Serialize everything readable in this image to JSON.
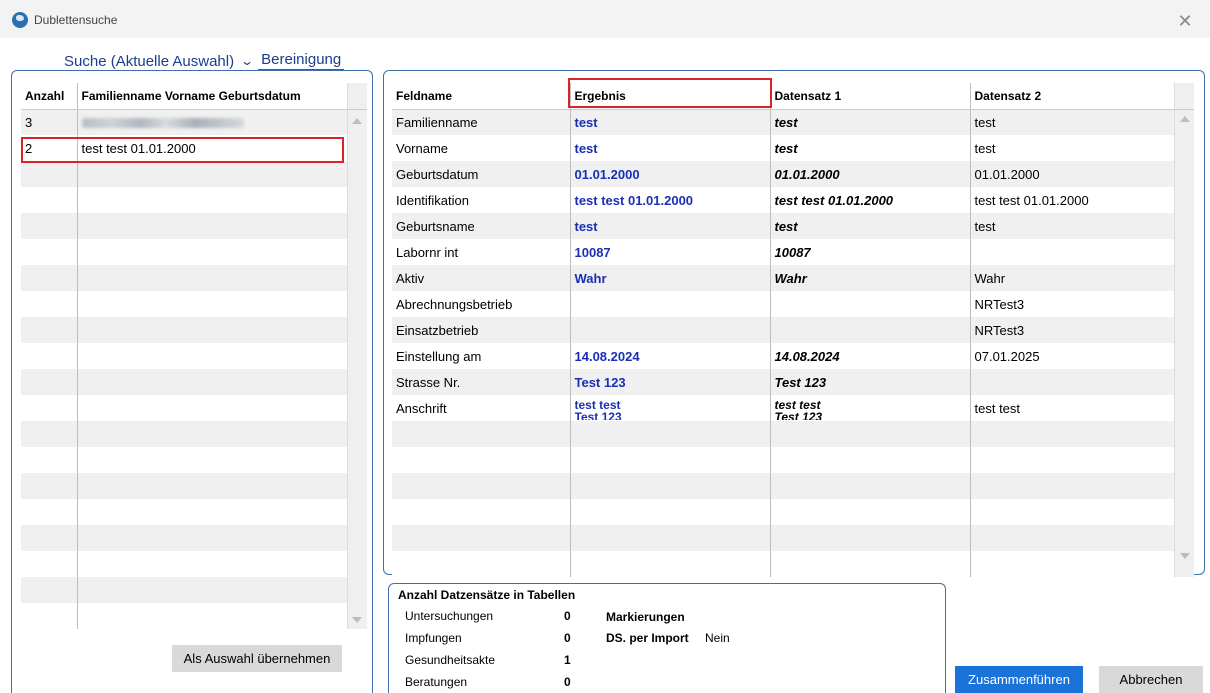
{
  "window": {
    "title": "Dublettensuche",
    "close_glyph": "✕",
    "icon": "globe-icon"
  },
  "tabs": {
    "search": "Suche (Aktuelle Auswahl)",
    "chevron": "⌄",
    "cleanup": "Bereinigung"
  },
  "left": {
    "col_count": "Anzahl",
    "col_name": "Familienname Vorname Geburtsdatum",
    "rows": [
      {
        "count": "3",
        "name": ""
      },
      {
        "count": "2",
        "name": "test test 01.01.2000"
      }
    ],
    "apply_button": "Als Auswahl übernehmen"
  },
  "right": {
    "col_field": "Feldname",
    "col_result": "Ergebnis",
    "col_ds1": "Datensatz 1",
    "col_ds2": "Datensatz 2",
    "rows": [
      {
        "field": "Familienname",
        "result": "test",
        "ds1": "test",
        "ds2": "test"
      },
      {
        "field": "Vorname",
        "result": "test",
        "ds1": "test",
        "ds2": "test"
      },
      {
        "field": "Geburtsdatum",
        "result": "01.01.2000",
        "ds1": "01.01.2000",
        "ds2": "01.01.2000"
      },
      {
        "field": "Identifikation",
        "result": "test test  01.01.2000",
        "ds1": "test test  01.01.2000",
        "ds2": "test test  01.01.2000"
      },
      {
        "field": "Geburtsname",
        "result": "test",
        "ds1": "test",
        "ds2": "test"
      },
      {
        "field": "Labornr int",
        "result": "10087",
        "ds1": "10087",
        "ds2": ""
      },
      {
        "field": "Aktiv",
        "result": "Wahr",
        "ds1": "Wahr",
        "ds2": "Wahr"
      },
      {
        "field": "Abrechnungsbetrieb",
        "result": "",
        "ds1": "",
        "ds2": "NRTest3"
      },
      {
        "field": "Einsatzbetrieb",
        "result": "",
        "ds1": "",
        "ds2": "NRTest3"
      },
      {
        "field": "Einstellung am",
        "result": "14.08.2024",
        "ds1": "14.08.2024",
        "ds2": "07.01.2025"
      },
      {
        "field": "Strasse Nr.",
        "result": "Test 123",
        "ds1": "Test 123",
        "ds2": ""
      },
      {
        "field": "Anschrift",
        "result": "test test\nTest 123",
        "ds1": "test test\nTest 123",
        "ds2": "test test"
      }
    ]
  },
  "counts": {
    "title": "Anzahl Datzensätze in Tabellen",
    "items": [
      {
        "label": "Untersuchungen",
        "value": "0"
      },
      {
        "label": "Impfungen",
        "value": "0"
      },
      {
        "label": "Gesundheitsakte",
        "value": "1"
      },
      {
        "label": "Beratungen",
        "value": "0"
      }
    ],
    "markings_label": "Markierungen",
    "import_label": "DS. per Import",
    "import_value": "Nein"
  },
  "buttons": {
    "merge": "Zusammenführen",
    "cancel": "Abbrechen"
  },
  "colors": {
    "accent": "#1a73d9",
    "highlight": "#d9242b",
    "result_text": "#1a2fb8",
    "panel_border": "#3f6faa"
  }
}
